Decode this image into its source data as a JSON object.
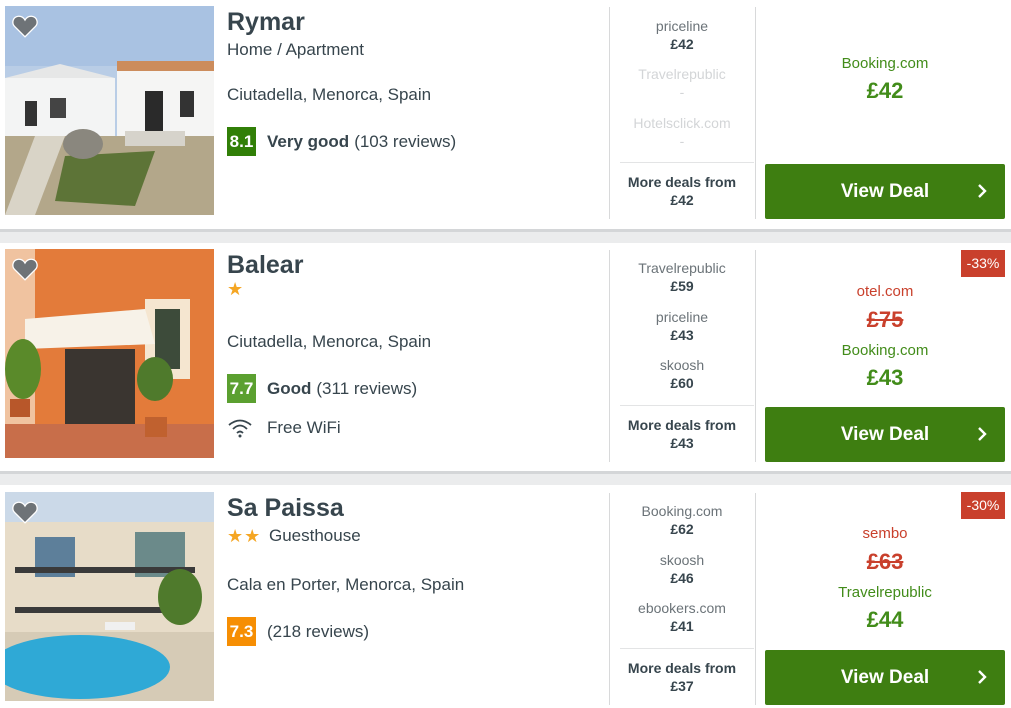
{
  "hotels": [
    {
      "name": "Rymar",
      "subtype": "Home / Apartment",
      "stars": "",
      "location": "Ciutadella, Menorca, Spain",
      "score": "8.1",
      "score_label": "Very good",
      "reviews": "(103 reviews)",
      "amenity": "",
      "deals": [
        {
          "provider": "priceline",
          "price": "£42"
        },
        {
          "provider": "Travelrepublic",
          "price": "-"
        },
        {
          "provider": "Hotelsclick.com",
          "price": "-"
        }
      ],
      "more_deals_label": "More deals from",
      "more_deals_price": "£42",
      "discount": "",
      "old_provider": "",
      "old_price": "",
      "best_provider": "Booking.com",
      "best_price": "£42",
      "cta": "View Deal"
    },
    {
      "name": "Balear",
      "subtype": "",
      "stars": "★",
      "location": "Ciutadella, Menorca, Spain",
      "score": "7.7",
      "score_label": "Good",
      "reviews": "(311 reviews)",
      "amenity": "Free WiFi",
      "deals": [
        {
          "provider": "Travelrepublic",
          "price": "£59"
        },
        {
          "provider": "priceline",
          "price": "£43"
        },
        {
          "provider": "skoosh",
          "price": "£60"
        }
      ],
      "more_deals_label": "More deals from",
      "more_deals_price": "£43",
      "discount": "-33%",
      "old_provider": "otel.com",
      "old_price": "£75",
      "best_provider": "Booking.com",
      "best_price": "£43",
      "cta": "View Deal"
    },
    {
      "name": "Sa Paissa",
      "subtype": "Guesthouse",
      "stars": "★★",
      "location": "Cala en Porter, Menorca, Spain",
      "score": "7.3",
      "score_label": "",
      "reviews": "(218 reviews)",
      "amenity": "",
      "deals": [
        {
          "provider": "Booking.com",
          "price": "£62"
        },
        {
          "provider": "skoosh",
          "price": "£46"
        },
        {
          "provider": "ebookers.com",
          "price": "£41"
        }
      ],
      "more_deals_label": "More deals from",
      "more_deals_price": "£37",
      "discount": "-30%",
      "old_provider": "sembo",
      "old_price": "£63",
      "best_provider": "Travelrepublic",
      "best_price": "£44",
      "cta": "View Deal"
    }
  ],
  "colors": {
    "score_very_good": "#317f07",
    "score_good": "#5ba030",
    "score_orange": "#f68e03",
    "cta_green": "#3e7e11",
    "price_green": "#428c1a",
    "strike_red": "#c9402c",
    "star": "#f5a623"
  },
  "icons": [
    "heart-icon",
    "wifi-icon",
    "chevron-right-icon",
    "star-icon"
  ]
}
